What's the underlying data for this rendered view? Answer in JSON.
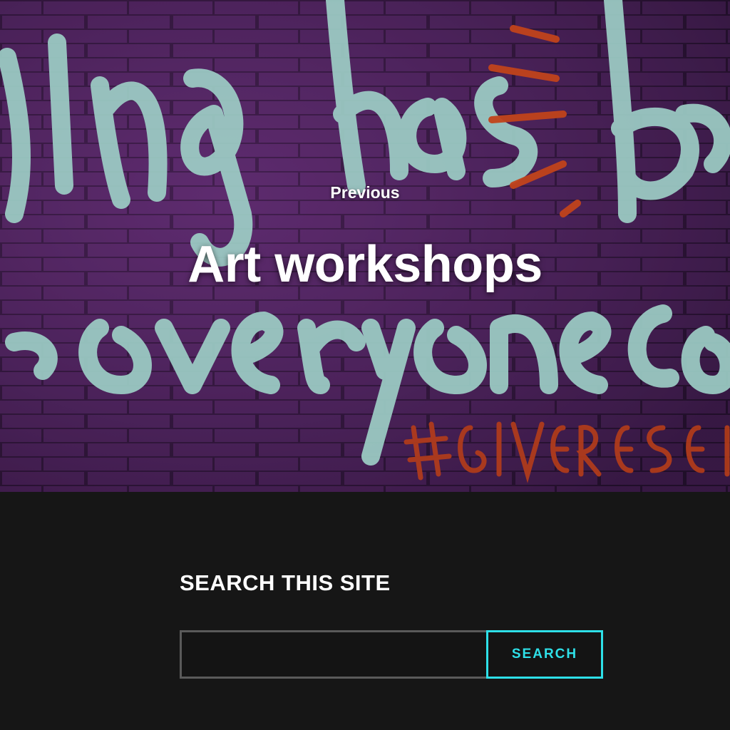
{
  "hero": {
    "nav_label": "Previous",
    "post_title": "Art workshops",
    "image_graffiti_text": "hing has be everyone ca #GIVEPRESENC"
  },
  "widget": {
    "title": "SEARCH THIS SITE",
    "search_placeholder": "",
    "search_value": "",
    "search_button_label": "SEARCH"
  },
  "colors": {
    "background": "#161616",
    "accent": "#2ee0e8",
    "graffiti_mint": "#b5f2e4",
    "graffiti_orange": "#e0501c",
    "brick": "#5c2f6e"
  }
}
